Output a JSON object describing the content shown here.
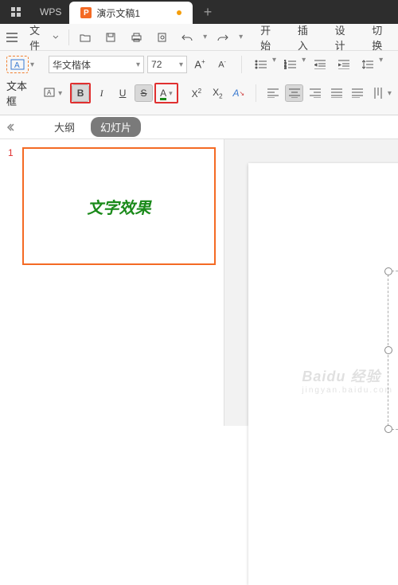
{
  "titlebar": {
    "app_name": "WPS",
    "tab_title": "演示文稿1",
    "new_tab": "+"
  },
  "menubar": {
    "file_label": "文件",
    "tabs": {
      "start": "开始",
      "insert": "插入",
      "design": "设计",
      "transition": "切换"
    }
  },
  "ribbon": {
    "textbox_label": "文本框",
    "font_name": "华文楷体",
    "font_size": "72"
  },
  "panel": {
    "outline": "大纲",
    "slides": "幻灯片"
  },
  "slide": {
    "number": "1",
    "text": "文字效果"
  },
  "watermark": {
    "main": "Baidu 经验",
    "sub": "jingyan.baidu.com"
  }
}
